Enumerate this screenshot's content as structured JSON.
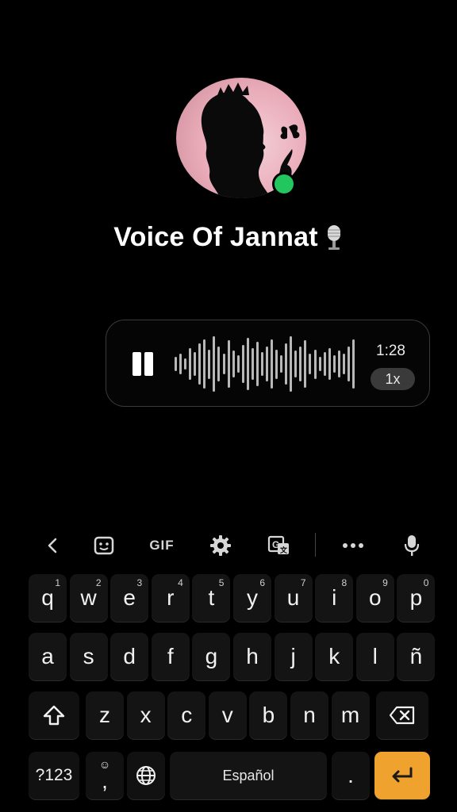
{
  "profile": {
    "name": "Voice Of Jannat",
    "name_emoji": "studio-microphone-emoji",
    "online": true,
    "status_color": "#22c55e"
  },
  "voice_message": {
    "state": "playing",
    "duration": "1:28",
    "speed": "1x",
    "waveform_levels": [
      0.25,
      0.35,
      0.2,
      0.55,
      0.4,
      0.7,
      0.85,
      0.5,
      0.95,
      0.6,
      0.35,
      0.8,
      0.45,
      0.3,
      0.65,
      0.9,
      0.55,
      0.75,
      0.4,
      0.6,
      0.85,
      0.5,
      0.3,
      0.7,
      0.95,
      0.45,
      0.6,
      0.8,
      0.35,
      0.5,
      0.25,
      0.4,
      0.55,
      0.3,
      0.45,
      0.35,
      0.6,
      0.85
    ]
  },
  "keyboard": {
    "toolbar": [
      {
        "id": "back",
        "icon": "chevron-left-icon"
      },
      {
        "id": "sticker",
        "icon": "sticker-icon"
      },
      {
        "id": "gif",
        "label": "GIF"
      },
      {
        "id": "settings",
        "icon": "gear-icon"
      },
      {
        "id": "translate",
        "icon": "translate-icon"
      },
      {
        "id": "more",
        "icon": "more-horizontal-icon"
      },
      {
        "id": "voice",
        "icon": "microphone-icon"
      }
    ],
    "row1": [
      {
        "k": "q",
        "h": "1"
      },
      {
        "k": "w",
        "h": "2"
      },
      {
        "k": "e",
        "h": "3"
      },
      {
        "k": "r",
        "h": "4"
      },
      {
        "k": "t",
        "h": "5"
      },
      {
        "k": "y",
        "h": "6"
      },
      {
        "k": "u",
        "h": "7"
      },
      {
        "k": "i",
        "h": "8"
      },
      {
        "k": "o",
        "h": "9"
      },
      {
        "k": "p",
        "h": "0"
      }
    ],
    "row2": [
      "a",
      "s",
      "d",
      "f",
      "g",
      "h",
      "j",
      "k",
      "l",
      "ñ"
    ],
    "row3": [
      "z",
      "x",
      "c",
      "v",
      "b",
      "n",
      "m"
    ],
    "symbols_label": "?123",
    "comma_label": ",",
    "space_label": "Español",
    "period_label": ".",
    "accent_color": "#f0a22e"
  }
}
